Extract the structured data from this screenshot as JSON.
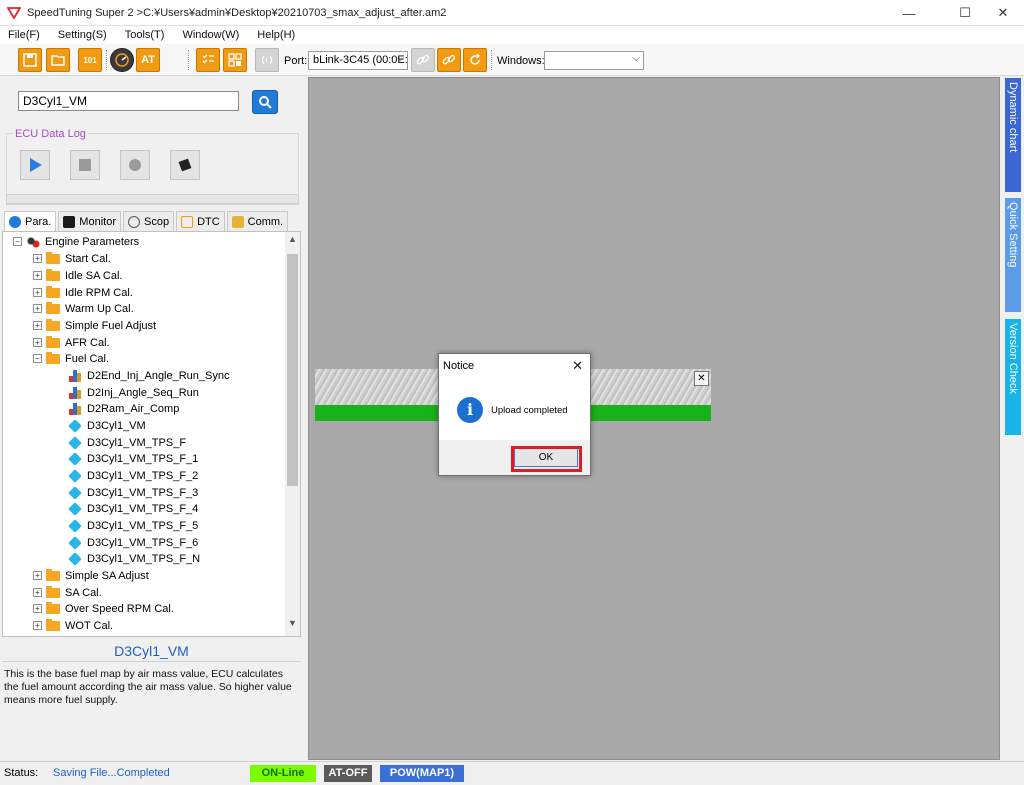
{
  "window": {
    "title": "SpeedTuning Super 2  >C:¥Users¥admin¥Desktop¥20210703_smax_adjust_after.am2",
    "minimize": "—",
    "maximize": "☐",
    "close": "✕"
  },
  "menu": [
    "File(F)",
    "Setting(S)",
    "Tools(T)",
    "Window(W)",
    "Help(H)"
  ],
  "toolbar": {
    "port_label": "Port:",
    "port_value": "bLink-3C45 (00:0E:",
    "windows_label": "Windows:",
    "windows_value": "",
    "btn_101": "101",
    "btn_at": "AT"
  },
  "search": {
    "value": "D3Cyl1_VM"
  },
  "ecu_log": {
    "label": "ECU Data Log"
  },
  "tabs": [
    "Para.",
    "Monitor",
    "Scop",
    "DTC",
    "Comm."
  ],
  "tree": {
    "root": "Engine Parameters",
    "folders_top": [
      "Start Cal.",
      "Idle SA Cal.",
      "Idle RPM Cal.",
      "Warm Up Cal.",
      "Simple Fuel Adjust",
      "AFR Cal.",
      "Fuel Cal."
    ],
    "fuel_children_chart": [
      "D2End_Inj_Angle_Run_Sync",
      "D2Inj_Angle_Seq_Run",
      "D2Ram_Air_Comp"
    ],
    "fuel_children_map": [
      "D3Cyl1_VM",
      "D3Cyl1_VM_TPS_F",
      "D3Cyl1_VM_TPS_F_1",
      "D3Cyl1_VM_TPS_F_2",
      "D3Cyl1_VM_TPS_F_3",
      "D3Cyl1_VM_TPS_F_4",
      "D3Cyl1_VM_TPS_F_5",
      "D3Cyl1_VM_TPS_F_6",
      "D3Cyl1_VM_TPS_F_N"
    ],
    "folders_bottom": [
      "Simple SA Adjust",
      "SA Cal.",
      "Over Speed RPM Cal.",
      "WOT Cal."
    ]
  },
  "selected": {
    "name": "D3Cyl1_VM",
    "description": "This is the base fuel map by air mass value, ECU calculates the fuel amount according the air mass value. So higher value means more fuel supply."
  },
  "dialog": {
    "title": "Notice",
    "message": "Upload completed",
    "ok": "OK",
    "close": "✕"
  },
  "overlay_close": "✕",
  "side_tabs": [
    "Dynamic chart",
    "Quick Setting",
    "Version Check"
  ],
  "status": {
    "label": "Status:",
    "text": "Saving File...Completed",
    "online": "ON-Line",
    "at": "AT-OFF",
    "pow": "POW(MAP1)"
  },
  "colors": {
    "accent_orange": "#f29a12",
    "online_green": "#7cfc00",
    "pow_blue": "#3b6fd8",
    "side_dynamic": "#3a66d6",
    "side_quick": "#5b9be8",
    "side_version": "#18b4e8"
  }
}
